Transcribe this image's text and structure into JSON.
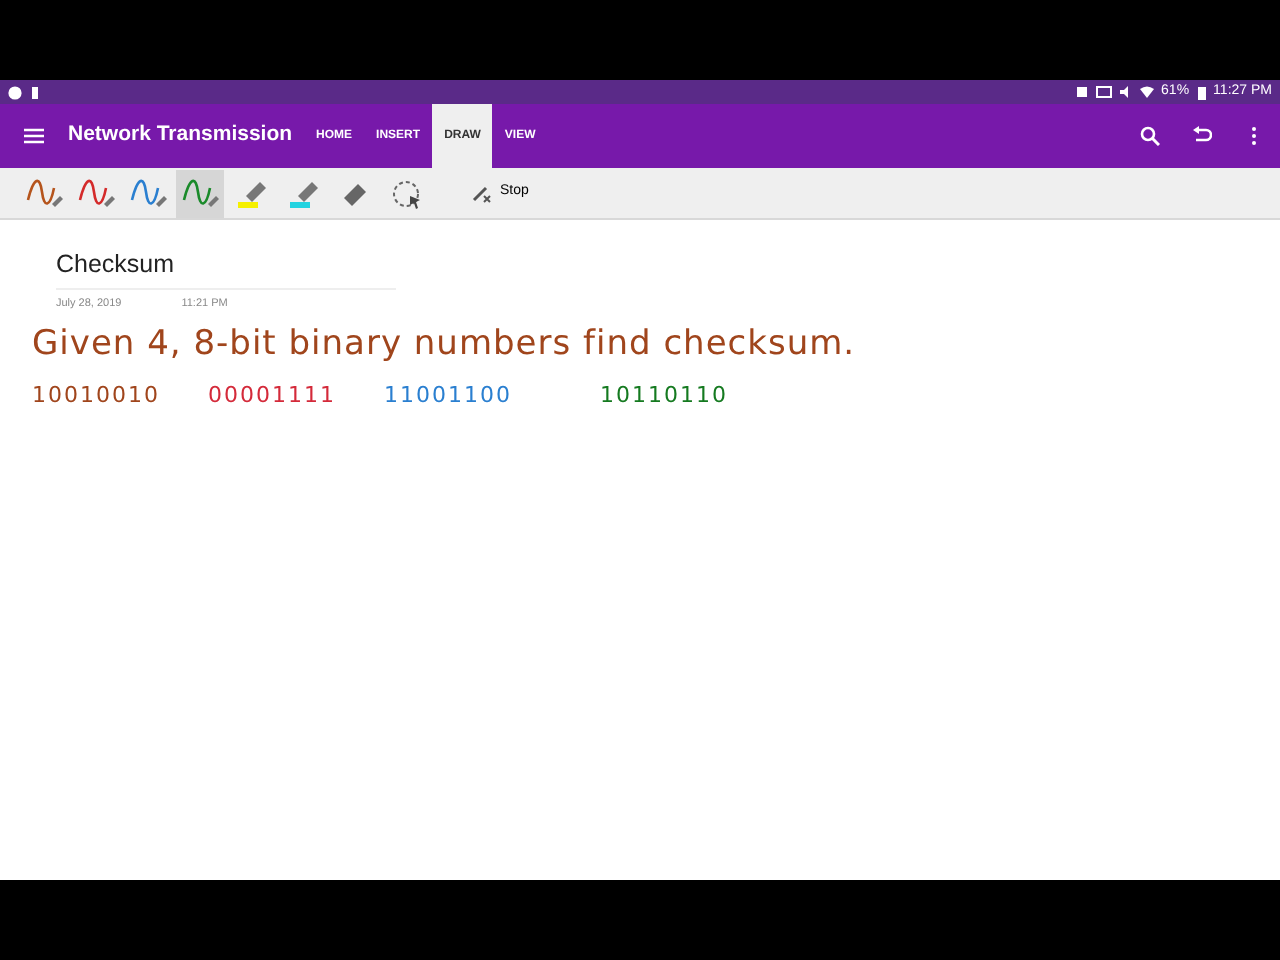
{
  "status_bar": {
    "battery": "61%",
    "time": "11:27 PM"
  },
  "app_bar": {
    "title": "Network Transmission",
    "tabs": [
      {
        "label": "HOME",
        "selected": false
      },
      {
        "label": "INSERT",
        "selected": false
      },
      {
        "label": "DRAW",
        "selected": true
      },
      {
        "label": "VIEW",
        "selected": false
      }
    ]
  },
  "tools": [
    {
      "kind": "pen",
      "color": "#b5541c",
      "selected": false
    },
    {
      "kind": "pen",
      "color": "#d42a2a",
      "selected": false
    },
    {
      "kind": "pen",
      "color": "#2a7fd0",
      "selected": false
    },
    {
      "kind": "pen",
      "color": "#1a8a2a",
      "selected": true
    },
    {
      "kind": "highlighter",
      "color": "#f5f000",
      "selected": false
    },
    {
      "kind": "highlighter",
      "color": "#22d3e0",
      "selected": false
    },
    {
      "kind": "eraser",
      "selected": false
    },
    {
      "kind": "lasso",
      "selected": false
    }
  ],
  "stop": {
    "label": "Stop"
  },
  "page": {
    "title": "Checksum",
    "date": "July 28, 2019",
    "time": "11:21 PM",
    "ink_text": {
      "text": "Given 4, 8-bit binary numbers find checksum.",
      "color": "#a0451c"
    },
    "numbers": [
      {
        "text": "10010010",
        "color": "#a0451c"
      },
      {
        "text": "00001111",
        "color": "#d42a3a"
      },
      {
        "text": "11001100",
        "color": "#2a7fd0"
      },
      {
        "text": "10110110",
        "color": "#157a20"
      }
    ]
  }
}
